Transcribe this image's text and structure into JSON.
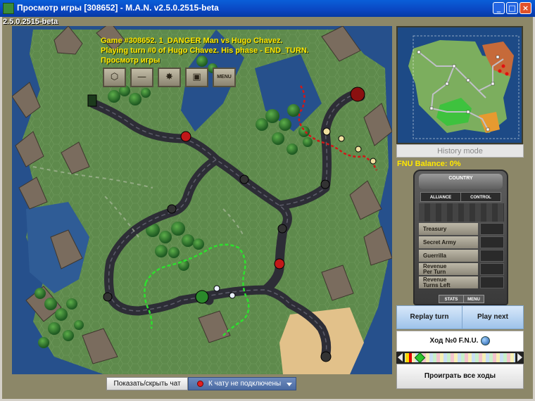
{
  "window": {
    "title": "Просмотр игры [308652] - M.A.N. v2.5.0.2515-beta",
    "minimize_glyph": "_",
    "maximize_glyph": "□",
    "close_glyph": "×"
  },
  "version_label": "2.5.0.2515-beta",
  "game_info": {
    "line1": "Game #308652. 1_DANGER Man vs Hugo Chavez.",
    "line2": "Playing turn #0 of Hugo Chavez. His phase - END_TURN.",
    "line3": "Просмотр игры"
  },
  "toolbar": {
    "menu_label": "MENU",
    "icons": [
      "hex-icon",
      "line-icon",
      "explosion-icon",
      "camera-icon",
      "menu-icon"
    ]
  },
  "sidebar": {
    "history_mode": "History mode",
    "fnu_balance": "FNU Balance: 0%",
    "country_panel": {
      "header": "COUNTRY",
      "tabs": [
        "ALLIANCE",
        "CONTROL"
      ],
      "rows": [
        "Treasury",
        "Secret Army",
        "Guerrilla",
        "Revenue\nPer Turn",
        "Revenue\nTurns Left"
      ],
      "bottom_tabs": [
        "STATS",
        "MENU"
      ]
    },
    "replay_turn": "Replay turn",
    "play_next": "Play next",
    "turn_label": "Ход №0 F.N.U.",
    "play_all": "Проиграть все ходы"
  },
  "chat": {
    "toggle_label": "Показать/скрыть чат",
    "status_label": "К чату не подключены",
    "status_color": "#e02020"
  },
  "colors": {
    "title_bar": "#0a46c2",
    "overlay_text": "#ffe800",
    "water": "#26508c",
    "land": "#5e8a4c",
    "road": "#3a3a44",
    "red_border": "#d01818",
    "green_border": "#2ee02e"
  }
}
